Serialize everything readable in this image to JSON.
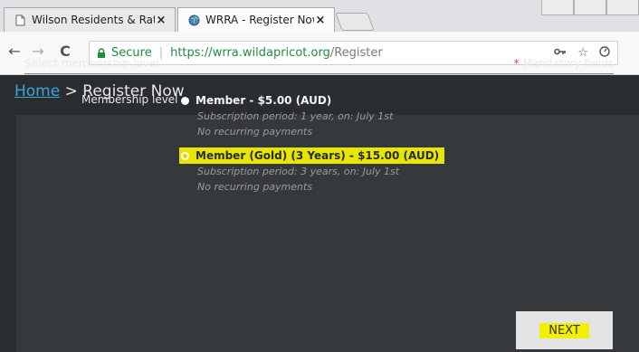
{
  "browser": {
    "tabs": [
      {
        "title": "Wilson Residents & Rate",
        "close": "×",
        "active": false
      },
      {
        "title": "WRRA - Register Now",
        "close": "×",
        "active": true
      }
    ],
    "nav": {
      "back": "←",
      "forward": "→",
      "reload": "C"
    },
    "address": {
      "secure_label": "Secure",
      "url_host": "https://wrra.wildapricot.org",
      "url_path": "/Register"
    }
  },
  "page": {
    "breadcrumb": {
      "home": "Home",
      "separator": ">",
      "current": "Register Now"
    },
    "section_title": "Select membership level",
    "mandatory": {
      "star": "*",
      "label": "Mandatory fields"
    },
    "membership_label": "Membership level",
    "options": [
      {
        "title": "Member - $5.00 (AUD)",
        "period": "Subscription period: 1 year, on: July 1st",
        "recurring": "No recurring payments",
        "selected": false
      },
      {
        "title": "Member (Gold) (3 Years) - $15.00 (AUD)",
        "period": "Subscription period: 3 years, on: July 1st",
        "recurring": "No recurring payments",
        "selected": true
      }
    ],
    "next_label": "NEXT"
  },
  "colors": {
    "page_bg": "#2a2d30",
    "panel_bg": "#36393c",
    "link": "#3aa6d8",
    "highlight": "#e6e600",
    "mandatory_star": "#e0463a",
    "secure_green": "#1e8e3e"
  }
}
